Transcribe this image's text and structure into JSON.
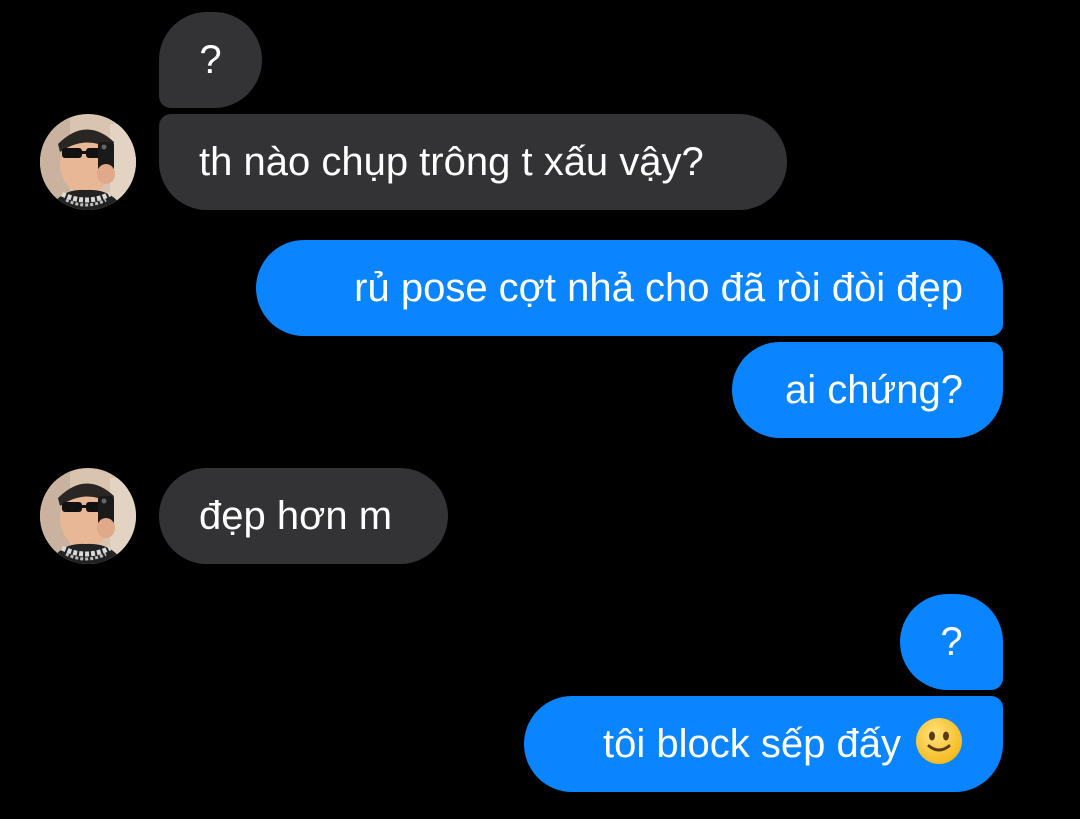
{
  "conversation": {
    "messages": [
      {
        "sender": "them",
        "text": "?"
      },
      {
        "sender": "them",
        "text": "th nào chụp trông t xấu vậy?"
      },
      {
        "sender": "me",
        "text": "rủ pose cợt nhả cho đã ròi đòi đẹp"
      },
      {
        "sender": "me",
        "text": "ai chứng?"
      },
      {
        "sender": "them",
        "text": "đẹp hơn m"
      },
      {
        "sender": "me",
        "text": "?"
      },
      {
        "sender": "me",
        "text": "tôi block sếp đấy",
        "emoji": "slightly-smiling-face"
      }
    ]
  },
  "colors": {
    "background": "#000000",
    "incoming_bubble": "#333336",
    "outgoing_bubble": "#0a84ff",
    "text": "#ffffff"
  }
}
